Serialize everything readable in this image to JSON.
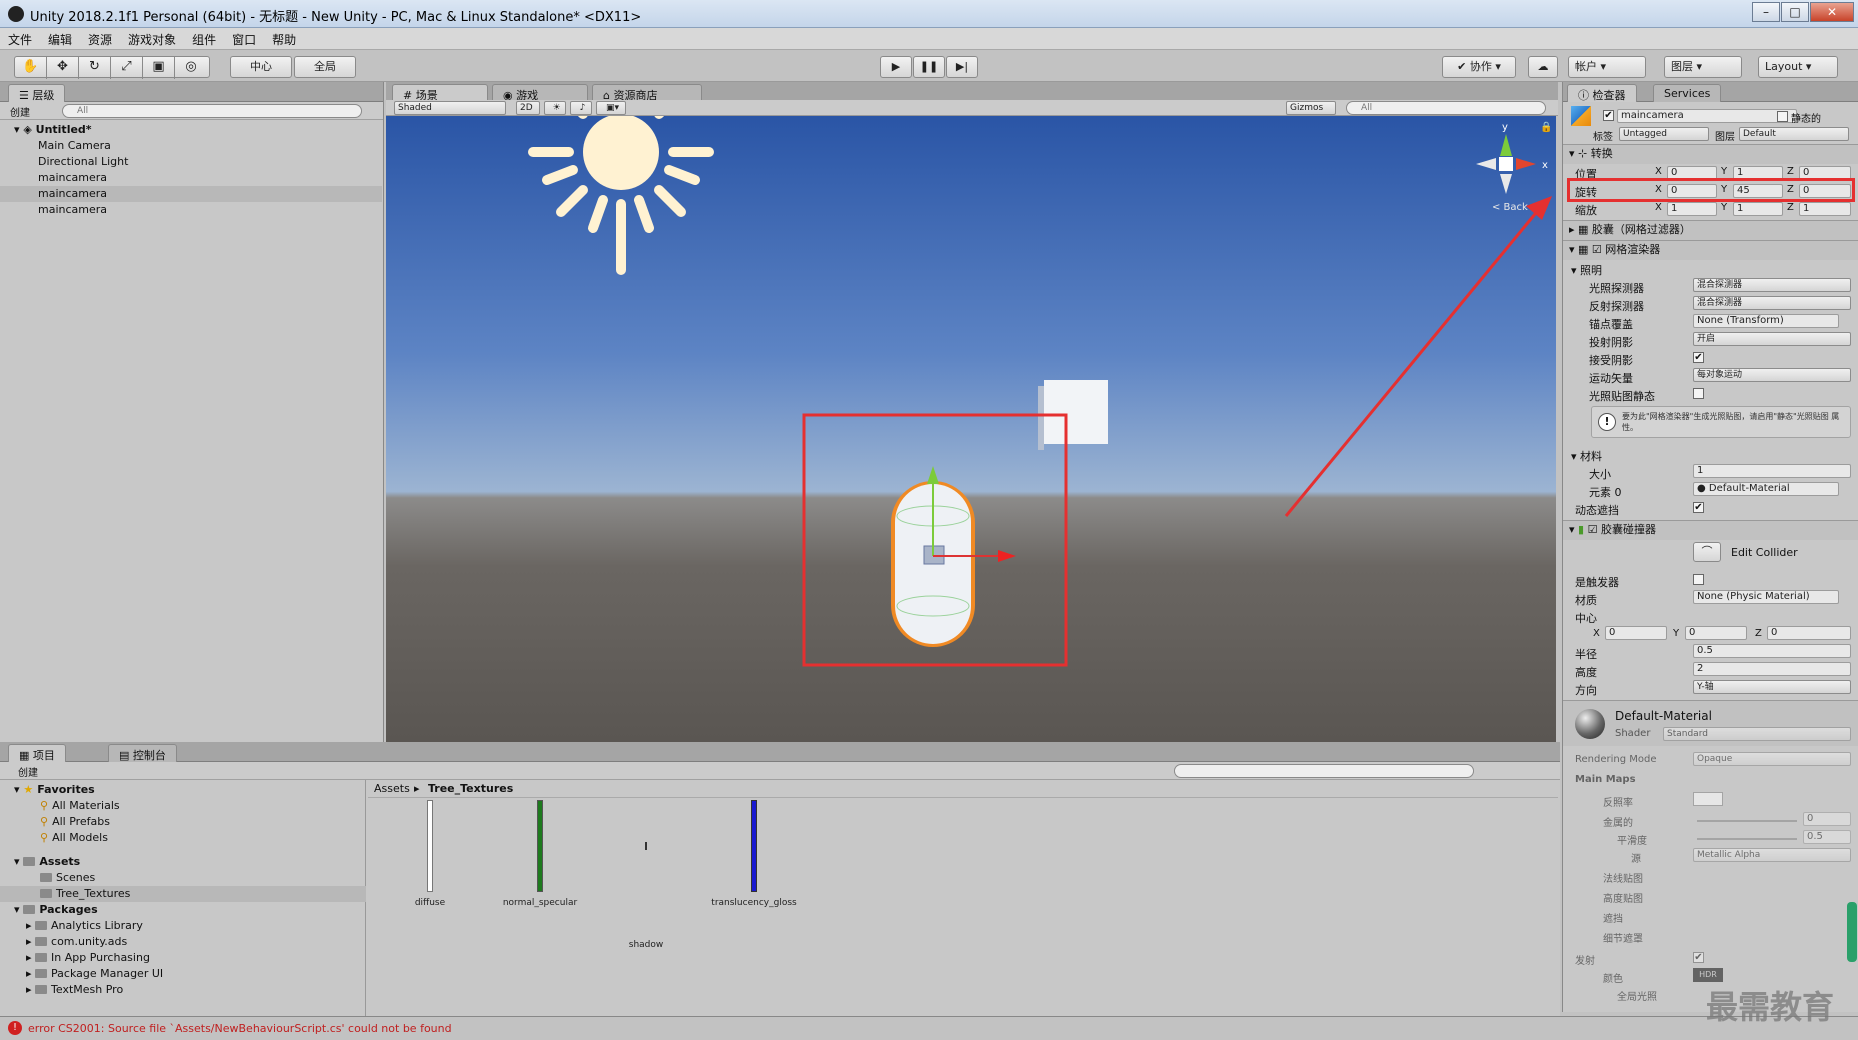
{
  "window": {
    "title": "Unity 2018.2.1f1 Personal (64bit) - 无标题 - New Unity - PC, Mac & Linux Standalone* <DX11>"
  },
  "menu": [
    "文件",
    "编辑",
    "资源",
    "游戏对象",
    "组件",
    "窗口",
    "帮助"
  ],
  "toolbar": {
    "pivot": "中心",
    "global": "全局",
    "collab": "协作",
    "account": "帐户",
    "layers": "图层",
    "layout": "Layout"
  },
  "hierarchy": {
    "tab": "层级",
    "create": "创建",
    "search_placeholder": "All",
    "scene": "Untitled*",
    "items": [
      "Main Camera",
      "Directional Light",
      "maincamera",
      "maincamera",
      "maincamera"
    ]
  },
  "scene_view": {
    "tabs": [
      "场景",
      "游戏",
      "资源商店"
    ],
    "shading": "Shaded",
    "mode2d": "2D",
    "gizmos": "Gizmos",
    "search_placeholder": "All",
    "gizmo_back": "< Back",
    "axis_y": "y",
    "axis_x": "x"
  },
  "inspector": {
    "tabs": [
      "检查器",
      "Services"
    ],
    "object_name": "maincamera",
    "static_label": "静态的",
    "tag_label": "标签",
    "tag": "Untagged",
    "layer_label": "图层",
    "layer": "Default",
    "transform": {
      "title": "转换",
      "position_label": "位置",
      "rotation_label": "旋转",
      "scale_label": "缩放",
      "position": {
        "x": "0",
        "y": "1",
        "z": "0"
      },
      "rotation": {
        "x": "0",
        "y": "45",
        "z": "0"
      },
      "scale": {
        "x": "1",
        "y": "1",
        "z": "1"
      }
    },
    "mesh_filter": "胶囊（网格过滤器）",
    "mesh_renderer": {
      "title": "网格渲染器",
      "lighting": "照明",
      "light_probes_label": "光照探测器",
      "light_probes": "混合探测器",
      "reflection_probes_label": "反射探测器",
      "reflection_probes": "混合探测器",
      "anchor_label": "锚点覆盖",
      "anchor": "None (Transform)",
      "cast_shadows_label": "投射阴影",
      "cast_shadows": "开启",
      "receive_shadows_label": "接受阴影",
      "motion_vectors_label": "运动矢量",
      "motion_vectors": "每对象运动",
      "lightmap_static_label": "光照贴图静态",
      "info": "要为此\"网格渲染器\"生成光照贴图，请启用\"静态\"光照贴图 属性。",
      "materials": "材料",
      "size_label": "大小",
      "size": "1",
      "element_label": "元素 0",
      "element": "Default-Material",
      "dynamic_occluded_label": "动态遮挡"
    },
    "capsule_collider": {
      "title": "胶囊碰撞器",
      "edit": "Edit Collider",
      "trigger_label": "是触发器",
      "material_label": "材质",
      "material": "None (Physic Material)",
      "center_label": "中心",
      "center": {
        "x": "0",
        "y": "0",
        "z": "0"
      },
      "radius_label": "半径",
      "radius": "0.5",
      "height_label": "高度",
      "height": "2",
      "direction_label": "方向",
      "direction": "Y-轴"
    },
    "material": {
      "name": "Default-Material",
      "shader_label": "Shader",
      "shader": "Standard",
      "rendering_mode_label": "Rendering Mode",
      "rendering_mode": "Opaque",
      "main_maps": "Main Maps",
      "albedo": "反照率",
      "metallic": "金属的",
      "metallic_val": "0",
      "smoothness": "平滑度",
      "smoothness_val": "0.5",
      "source": "源",
      "source_val": "Metallic Alpha",
      "normal_map": "法线贴图",
      "height_map": "高度贴图",
      "occlusion": "遮挡",
      "detail_mask": "细节遮罩",
      "emission": "发射",
      "color": "颜色",
      "hdr": "HDR",
      "gi": "全局光照"
    }
  },
  "project": {
    "tabs": [
      "项目",
      "控制台"
    ],
    "create": "创建",
    "favorites": "Favorites",
    "fav_items": [
      "All Materials",
      "All Prefabs",
      "All Models"
    ],
    "assets": "Assets",
    "asset_folders": [
      "Scenes",
      "Tree_Textures"
    ],
    "packages": "Packages",
    "package_items": [
      "Analytics Library",
      "com.unity.ads",
      "In App Purchasing",
      "Package Manager UI",
      "TextMesh Pro"
    ],
    "breadcrumb": [
      "Assets",
      "Tree_Textures"
    ],
    "files": [
      {
        "name": "diffuse",
        "color": "#ffffff"
      },
      {
        "name": "normal_specular",
        "color": "#1e7a1e"
      },
      {
        "name": "shadow",
        "color": "#f0f0f0"
      },
      {
        "name": "translucency_gloss",
        "color": "#1a1ad0"
      }
    ]
  },
  "status": {
    "error": "error CS2001: Source file `Assets/NewBehaviourScript.cs' could not be found"
  },
  "watermark": "最需教育",
  "colors": {
    "highlight": "#e53030",
    "selection": "#f08a24"
  }
}
